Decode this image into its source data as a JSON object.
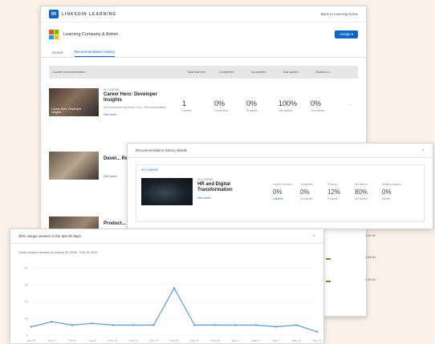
{
  "main": {
    "brand": "LINKEDIN LEARNING",
    "back_link": "Back to Learning home",
    "company_name": "Learning Company & Admin",
    "assign_label": "Assign ▾",
    "tabs": [
      "Details",
      "Recommendation History"
    ],
    "columns": [
      "Course recommendation",
      "Total learners",
      "Completed",
      "Incomplete",
      "Not started",
      "Started on ..."
    ],
    "course": {
      "kind": "IN COURSE",
      "title": "Career Hero: Developer Insights",
      "thumb_label": "Career Hero: Developer Insights",
      "meta": "Recommended by Admin Corp · Recommendation ·",
      "see_more": "See more",
      "stats": [
        {
          "value": "1",
          "label": "Learner"
        },
        {
          "value": "0%",
          "label": "Completed"
        },
        {
          "value": "0%",
          "label": "Progress"
        },
        {
          "value": "100%",
          "label": "Not started"
        },
        {
          "value": "0%",
          "label": "Incomplete"
        }
      ],
      "dots": "···"
    },
    "course2": {
      "title": "Devel... Report...",
      "see_more": "See more"
    },
    "course3": {
      "title": "Product..."
    }
  },
  "popup": {
    "title": "Recommendation history details",
    "close": "×",
    "inner_head": "IN COURSE",
    "course": {
      "kind": "IN COURSE",
      "title": "HR and Digital Transformation",
      "see_more": "See more"
    },
    "stats": [
      {
        "header": "Learner overview",
        "value": "0%",
        "label": "Learners"
      },
      {
        "header": "Completion",
        "value": "0%",
        "label": "Completed"
      },
      {
        "header": "Progress",
        "value": "12%",
        "label": "Progress"
      },
      {
        "header": "Not started",
        "value": "80%",
        "label": "Not started"
      },
      {
        "header": "Started progress",
        "value": "0%",
        "label": "Started"
      }
    ]
  },
  "side": {
    "row1": "1:00:00",
    "row2": "1:00:00",
    "row3": "1:00:00"
  },
  "chart": {
    "window_title": "30% unique viewers in the last 30 days",
    "subtitle": "Views unique viewers by unique 30 2018 - Feb 28 2019",
    "close": "×"
  },
  "chart_data": {
    "type": "line",
    "title": "",
    "xlabel": "",
    "ylabel": "",
    "ylim": [
      0,
      40
    ],
    "y_ticks": [
      0,
      10,
      20,
      30,
      40
    ],
    "x": [
      "Jan 30",
      "Feb 2",
      "Feb 5",
      "Feb 8",
      "Feb 11",
      "Feb 14",
      "Feb 17",
      "Feb 20",
      "Feb 23",
      "Feb 26",
      "Mar 1",
      "Mar 4",
      "Mar 7",
      "Mar 10",
      "Mar 13"
    ],
    "series": [
      {
        "values": [
          5,
          8,
          6,
          7,
          6,
          6,
          6,
          28,
          6,
          6,
          6,
          6,
          5,
          6,
          2
        ]
      }
    ],
    "grid": true,
    "color": "#5b9bd5"
  }
}
